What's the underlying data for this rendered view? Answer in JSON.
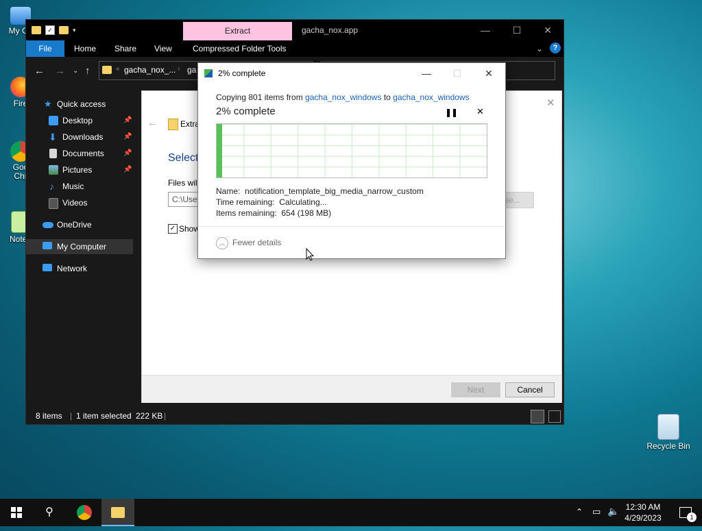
{
  "desktop": {
    "icons": [
      {
        "label": "My Co"
      },
      {
        "label": "Fire"
      },
      {
        "label": "Goo Chr"
      },
      {
        "label": "Notep"
      },
      {
        "label": "Recycle Bin"
      }
    ]
  },
  "explorer": {
    "context_tab": "Extract",
    "title": "gacha_nox.app",
    "ribbon": {
      "tabs": [
        "File",
        "Home",
        "Share",
        "View",
        "Compressed Folder Tools"
      ]
    },
    "breadcrumb": [
      "gacha_nox_...",
      "ga"
    ],
    "nav": [
      {
        "label": "Quick access",
        "pinned": false
      },
      {
        "label": "Desktop",
        "pinned": true
      },
      {
        "label": "Downloads",
        "pinned": true
      },
      {
        "label": "Documents",
        "pinned": true
      },
      {
        "label": "Pictures",
        "pinned": true
      },
      {
        "label": "Music",
        "pinned": false
      },
      {
        "label": "Videos",
        "pinned": false
      },
      {
        "label": "OneDrive",
        "pinned": false
      },
      {
        "label": "My Computer",
        "pinned": false
      },
      {
        "label": "Network",
        "pinned": false
      }
    ],
    "status": {
      "items": "8 items",
      "selected": "1 item selected",
      "size": "222 KB"
    }
  },
  "wizard": {
    "header": "Extra",
    "heading": "Select",
    "files_label": "Files will",
    "path_value": "C:\\User",
    "browse_label": "se...",
    "show_label": "Show",
    "next_label": "Next",
    "cancel_label": "Cancel"
  },
  "copy_dialog": {
    "title": "2% complete",
    "copying_prefix": "Copying 801 items from ",
    "source": "gacha_nox_windows",
    "to_word": " to ",
    "dest": "gacha_nox_windows",
    "percent_text": "2% complete",
    "progress": 0.02,
    "name_label": "Name:",
    "name_value": "notification_template_big_media_narrow_custom",
    "time_label": "Time remaining:",
    "time_value": "Calculating...",
    "items_label": "Items remaining:",
    "items_value": "654 (198 MB)",
    "fewer_details": "Fewer details"
  },
  "taskbar": {
    "time": "12:30 AM",
    "date": "4/29/2023",
    "notifications": "1"
  },
  "colors": {
    "accent": "#1979ca",
    "context_tab": "#ffc3e1",
    "progress_green": "#56c258"
  }
}
